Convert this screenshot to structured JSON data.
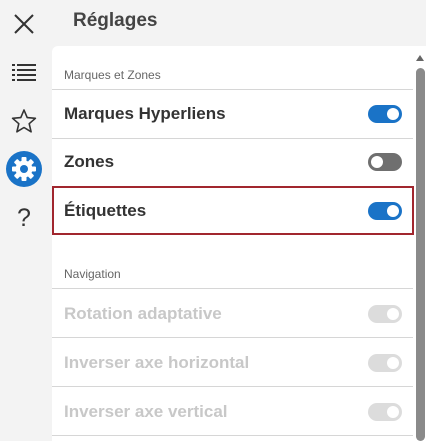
{
  "header": {
    "title": "Réglages"
  },
  "sidebar": {
    "items": [
      {
        "icon": "close-icon",
        "label": ""
      },
      {
        "icon": "list-icon",
        "label": ""
      },
      {
        "icon": "star-icon",
        "label": ""
      },
      {
        "icon": "gear-icon",
        "label": "",
        "active": true
      },
      {
        "icon": "help-icon",
        "label": "?"
      }
    ]
  },
  "sections": [
    {
      "label": "Marques et Zones",
      "items": [
        {
          "label": "Marques Hyperliens",
          "state": "on",
          "enabled": true
        },
        {
          "label": "Zones",
          "state": "off",
          "enabled": true
        },
        {
          "label": "Étiquettes",
          "state": "on",
          "enabled": true,
          "highlighted": true
        }
      ]
    },
    {
      "label": "Navigation",
      "items": [
        {
          "label": "Rotation adaptative",
          "state": "on",
          "enabled": false
        },
        {
          "label": "Inverser axe horizontal",
          "state": "on",
          "enabled": false
        },
        {
          "label": "Inverser axe vertical",
          "state": "on",
          "enabled": false
        }
      ]
    }
  ],
  "colors": {
    "accent": "#1a73c7",
    "highlight_border": "#a1262e",
    "toggle_off": "#6f6f6f",
    "toggle_disabled": "#dcdcdc"
  }
}
